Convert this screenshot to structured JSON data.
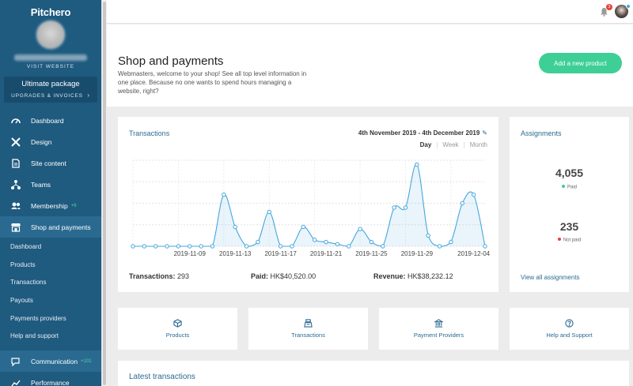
{
  "sidebar": {
    "brand": "Pitchero",
    "visit_website": "VISIT WEBSITE",
    "package": {
      "title": "Ultimate package",
      "subtitle": "UPGRADES & INVOICES"
    },
    "items": [
      {
        "label": "Dashboard",
        "icon": "speedometer-icon"
      },
      {
        "label": "Design",
        "icon": "tools-icon"
      },
      {
        "label": "Site content",
        "icon": "document-icon"
      },
      {
        "label": "Teams",
        "icon": "hierarchy-icon"
      },
      {
        "label": "Membership",
        "icon": "people-icon",
        "badge": "+6"
      },
      {
        "label": "Shop and payments",
        "icon": "store-icon"
      }
    ],
    "sub_items": [
      "Dashboard",
      "Products",
      "Transactions",
      "Payouts",
      "Payments providers",
      "Help and support"
    ],
    "bottom_items": [
      {
        "label": "Communication",
        "icon": "chat-icon",
        "badge": "+101"
      },
      {
        "label": "Performance",
        "icon": "trend-icon"
      }
    ]
  },
  "topbar": {
    "notification_count": "3",
    "bell_icon": "bell-icon",
    "avatar": "user-avatar"
  },
  "header": {
    "title": "Shop and payments",
    "description": "Webmasters, welcome to your shop! See all top level information in one place. Because no one wants to spend hours managing a website, right?",
    "add_product_label": "Add a new product"
  },
  "transactions": {
    "title": "Transactions",
    "date_range": "4th November 2019 - 4th December 2019",
    "ranges": [
      "Day",
      "Week",
      "Month"
    ],
    "active_range": "Day",
    "stats": {
      "transactions_label": "Transactions:",
      "transactions_value": "293",
      "paid_label": "Paid:",
      "paid_value": "HK$40,520.00",
      "revenue_label": "Revenue:",
      "revenue_value": "HK$38,232.12"
    }
  },
  "chart_data": {
    "type": "area",
    "x": [
      "2019-11-04",
      "2019-11-05",
      "2019-11-06",
      "2019-11-07",
      "2019-11-08",
      "2019-11-09",
      "2019-11-10",
      "2019-11-11",
      "2019-11-12",
      "2019-11-13",
      "2019-11-14",
      "2019-11-15",
      "2019-11-16",
      "2019-11-17",
      "2019-11-18",
      "2019-11-19",
      "2019-11-20",
      "2019-11-21",
      "2019-11-22",
      "2019-11-23",
      "2019-11-24",
      "2019-11-25",
      "2019-11-26",
      "2019-11-27",
      "2019-11-28",
      "2019-11-29",
      "2019-11-30",
      "2019-12-01",
      "2019-12-02",
      "2019-12-03",
      "2019-12-04"
    ],
    "values": [
      0,
      0,
      0,
      0,
      0,
      0,
      0,
      0,
      24,
      9,
      0,
      2,
      16,
      0,
      0,
      9,
      3,
      2,
      1,
      0,
      8,
      2,
      0,
      18,
      18,
      38,
      5,
      0,
      2,
      20,
      24,
      0
    ],
    "tick_labels": [
      "2019-11-09",
      "2019-11-13",
      "2019-11-17",
      "2019-11-21",
      "2019-11-25",
      "2019-11-29",
      "2019-12-04"
    ],
    "ylim": [
      0,
      40
    ],
    "grid": true,
    "color": "#47a6dc"
  },
  "assignments": {
    "title": "Assignments",
    "paid_value": "4,055",
    "paid_label": "Paid",
    "paid_color": "#3ecf96",
    "not_paid_value": "235",
    "not_paid_label": "Not paid",
    "not_paid_color": "#e2453c",
    "view_all": "View all assignments"
  },
  "quick_links": [
    {
      "label": "Products",
      "icon": "box-icon"
    },
    {
      "label": "Transactions",
      "icon": "cash-register-icon"
    },
    {
      "label": "Payment Providers",
      "icon": "bank-icon"
    },
    {
      "label": "Help and Support",
      "icon": "help-icon"
    }
  ],
  "latest": {
    "title": "Latest transactions"
  }
}
